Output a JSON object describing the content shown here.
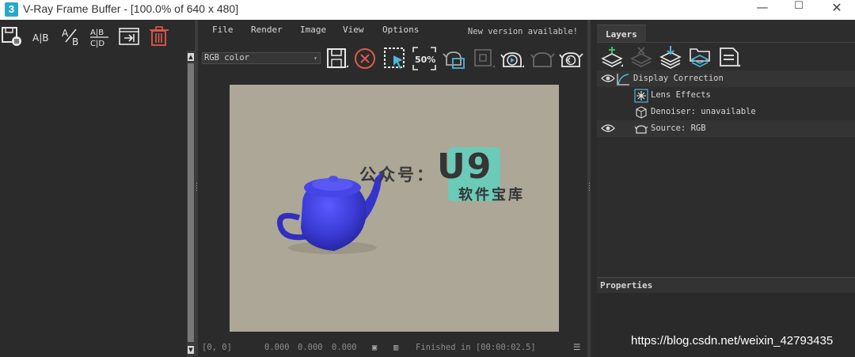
{
  "window": {
    "app_icon": "3",
    "title": "V-Ray Frame Buffer - [100.0% of 640 x 480]",
    "controls": {
      "minimize": "—",
      "maximize": "☐",
      "close": "✕"
    }
  },
  "left_toolbar": {
    "icons": [
      "save-history-icon",
      "ab-horizontal-compare-icon",
      "ab-vertical-compare-icon",
      "abcd-compare-icon",
      "load-to-render-icon",
      "delete-icon"
    ],
    "labels": {
      "ab": "A|B",
      "ab_slash": "A/B",
      "abcd_top": "A|B",
      "abcd_bottom": "C|D"
    }
  },
  "menu": {
    "items": [
      "File",
      "Render",
      "Image",
      "View",
      "Options"
    ],
    "notice": "New version available!"
  },
  "toolbar": {
    "channel": "RGB color",
    "zoom": "50%",
    "icons": [
      "save-icon",
      "clear-icon",
      "region-render-icon",
      "zoom-50-icon",
      "track-mouse-icon",
      "compare-icon",
      "interactive-render-icon",
      "stop-render-icon",
      "render-icon"
    ]
  },
  "render": {
    "background_color": "#aca797",
    "teapot_color": "#3f3fd8"
  },
  "overlay_watermark": {
    "prefix": "公众号：",
    "brand": "U9",
    "sub": "软件宝库",
    "box_color": "#6ccab8"
  },
  "status": {
    "coords": "[0, 0]",
    "v1": "0.000",
    "v2": "0.000",
    "v3": "0.000",
    "message": "Finished in [00:00:02.5]"
  },
  "layers_panel": {
    "tab": "Layers",
    "tools": [
      "add-layer-icon",
      "remove-layer-icon",
      "load-layers-icon",
      "save-layers-icon",
      "layer-list-icon"
    ],
    "rows": [
      {
        "label": "Display Correction",
        "visible": true
      },
      {
        "label": "Lens Effects",
        "visible": false
      },
      {
        "label": "Denoiser: unavailable",
        "visible": false
      },
      {
        "label": "Source: RGB",
        "visible": true
      }
    ],
    "properties_title": "Properties"
  },
  "footer_watermark": "https://blog.csdn.net/weixin_42793435"
}
